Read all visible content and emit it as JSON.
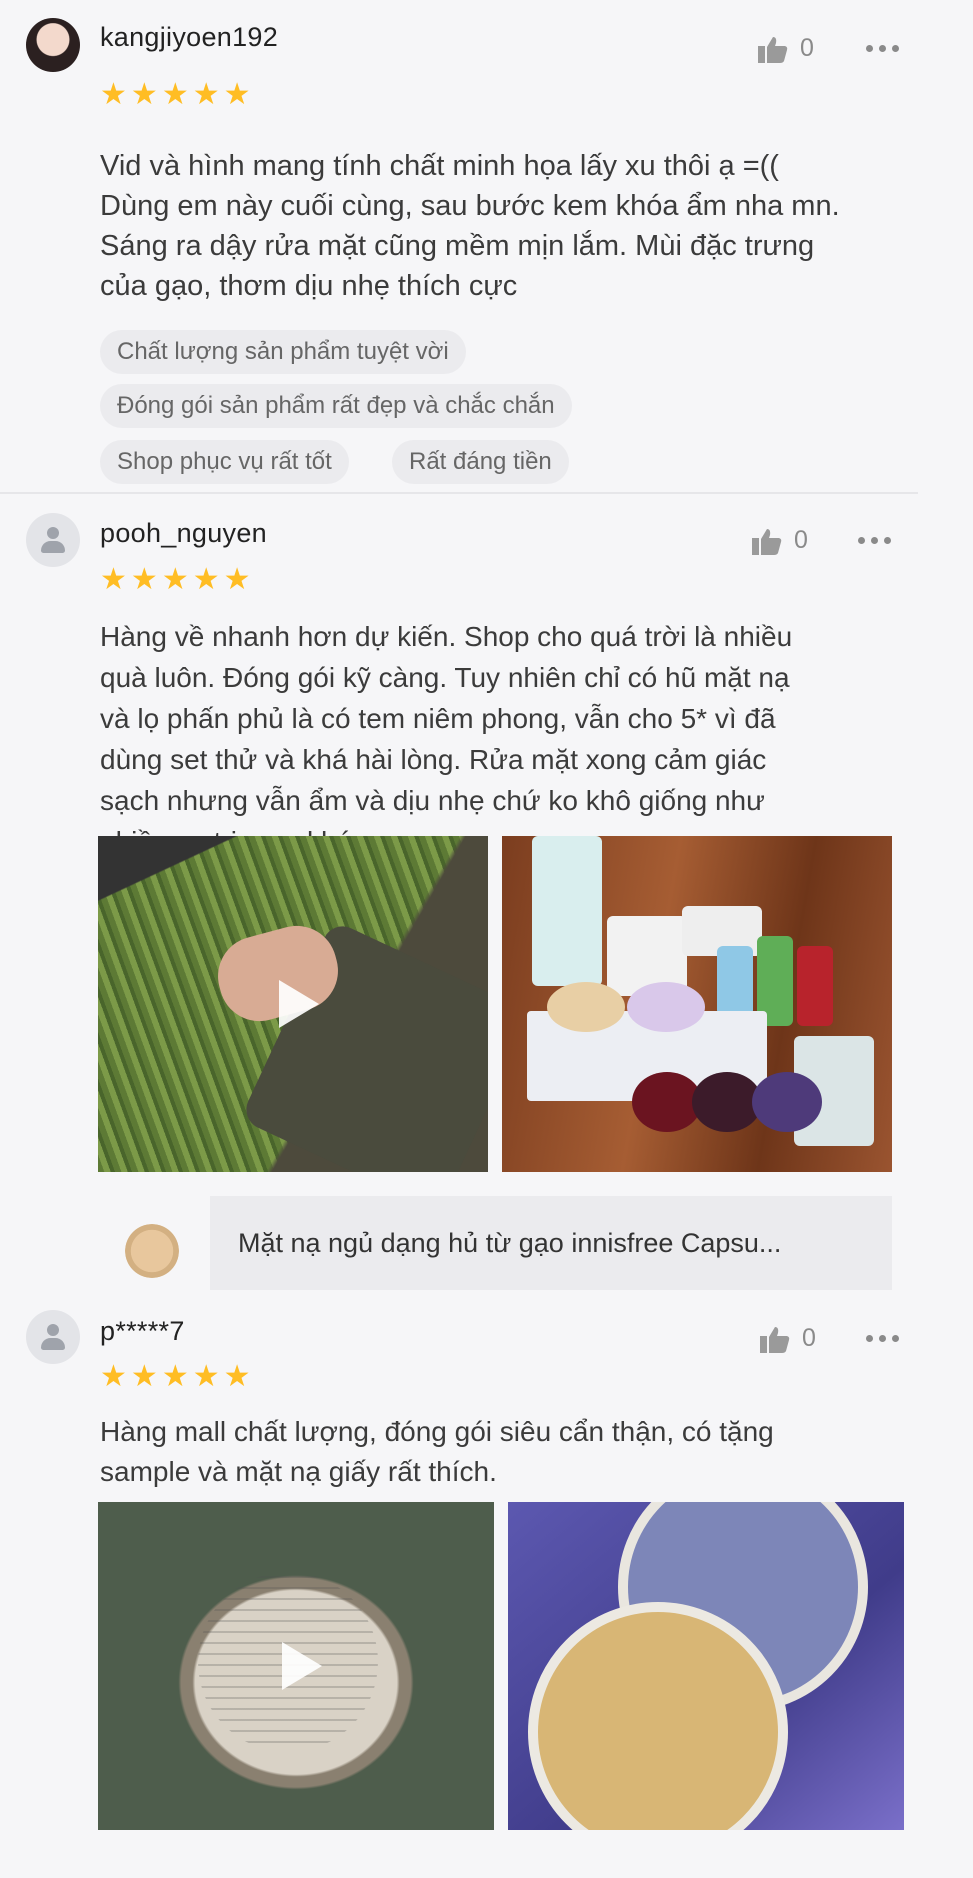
{
  "reviews": [
    {
      "username": "kangjiyoen192",
      "likes": "0",
      "stars": 5,
      "text": "Vid và hình mang tính chất minh họa lấy xu thôi ạ =((\nDùng em này cuối cùng, sau bước kem khóa ẩm nha mn.\nSáng ra dậy rửa mặt cũng mềm mịn lắm. Mùi đặc trưng\ncủa gạo, thơm dịu nhẹ thích cực",
      "tags": [
        "Chất lượng sản phẩm tuyệt vời",
        "Đóng gói sản phẩm rất đẹp và chắc chắn",
        "Shop phục vụ rất tốt",
        "Rất đáng tiền"
      ]
    },
    {
      "username": "pooh_nguyen",
      "likes": "0",
      "stars": 5,
      "text": "Hàng về nhanh hơn dự kiến. Shop cho quá trời là nhiều\nquà luôn. Đóng gói kỹ càng. Tuy nhiên chỉ có hũ mặt nạ\nvà lọ phấn phủ là có tem niêm phong, vẫn cho 5* vì đã\ndùng set thử và khá hài lòng. Rửa mặt xong cảm giác\nsạch nhưng vẫn ẩm và dịu nhẹ chứ ko khô giống như\nnhiều sp trị mụn khác",
      "product_name": "Mặt nạ ngủ dạng hủ từ gạo innisfree Capsu..."
    },
    {
      "username": "p*****7",
      "likes": "0",
      "stars": 5,
      "text": "Hàng mall chất lượng, đóng gói siêu cẩn thận, có tặng\nsample và mặt nạ giấy rất thích."
    }
  ],
  "icons": {
    "like": "thumbs-up-icon",
    "more": "more-dots-icon",
    "star": "star-icon",
    "play": "play-icon"
  },
  "colors": {
    "star": "#ffbd24",
    "background": "#f6f6f8",
    "tag_bg": "#ebebee"
  }
}
